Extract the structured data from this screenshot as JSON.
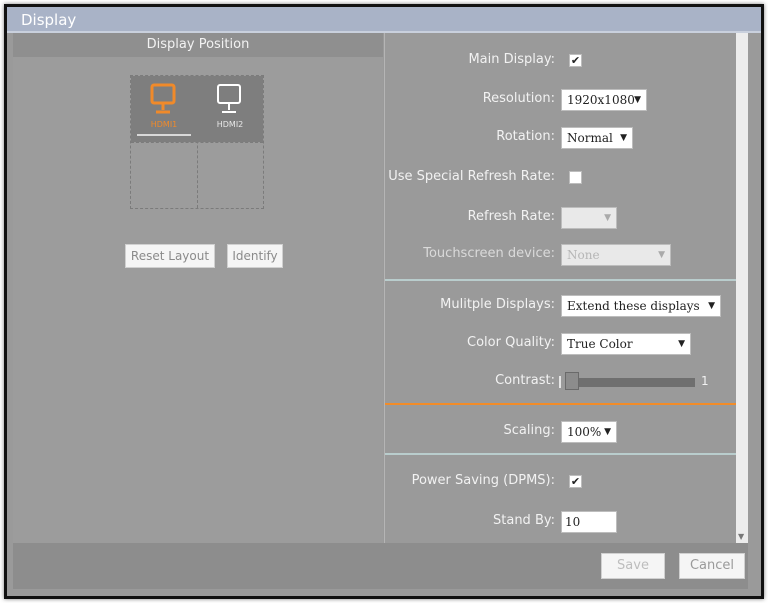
{
  "window": {
    "title": "Display"
  },
  "left": {
    "header": "Display Position",
    "monitors": [
      {
        "label": "HDMI1",
        "icon": "monitor-icon",
        "selected": true,
        "color": "#f08a2a"
      },
      {
        "label": "HDMI2",
        "icon": "monitor-icon",
        "selected": false,
        "color": "#ffffff"
      }
    ],
    "reset_label": "Reset Layout",
    "identify_label": "Identify"
  },
  "settings": {
    "main_display": {
      "label": "Main Display:",
      "checked": true,
      "mark": "✔"
    },
    "resolution": {
      "label": "Resolution:",
      "value": "1920x1080"
    },
    "rotation": {
      "label": "Rotation:",
      "value": "Normal"
    },
    "special_refresh": {
      "label": "Use Special Refresh Rate:",
      "checked": false
    },
    "refresh_rate": {
      "label": "Refresh Rate:",
      "value": ""
    },
    "touchscreen": {
      "label": "Touchscreen device:",
      "value": "None"
    },
    "multiple_displays": {
      "label": "Mulitple Displays:",
      "value": "Extend these displays"
    },
    "color_quality": {
      "label": "Color Quality:",
      "value": "True Color"
    },
    "contrast": {
      "label": "Contrast:",
      "max_label": "1",
      "level": 0
    },
    "scaling": {
      "label": "Scaling:",
      "value": "100%"
    },
    "power_saving": {
      "label": "Power Saving (DPMS):",
      "checked": true,
      "mark": "✔"
    },
    "stand_by": {
      "label": "Stand By:",
      "value": "10"
    },
    "dropdown_arrow": "▼"
  },
  "footer": {
    "save_label": "Save",
    "cancel_label": "Cancel"
  },
  "colors": {
    "accent": "#f28c28",
    "title_bar": "#a9b3c7",
    "panel": "#9a9a9a"
  }
}
